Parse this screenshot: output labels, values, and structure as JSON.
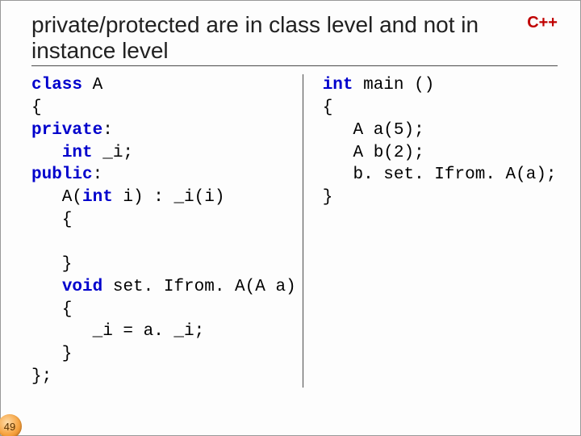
{
  "title": "private/protected are in class level and not in instance level",
  "lang_badge": "C++",
  "page_number": "49",
  "code_tokens": {
    "kw_class": "class",
    "kw_private": "private",
    "kw_public": "public",
    "kw_int": "int",
    "kw_void": "void"
  },
  "code_left": {
    "l1_rest": " A",
    "l2": "{",
    "l3_rest": ":",
    "l4_rest": " _i;",
    "l5_rest": ":",
    "l6_pre": "   A(",
    "l6_rest": " i) : _i(i)",
    "l7": "   {",
    "l8": "",
    "l9": "   }",
    "l10_rest": " set. Ifrom. A(A a)",
    "l11": "   {",
    "l12": "      _i = a. _i;",
    "l13": "   }",
    "l14": "};"
  },
  "code_right": {
    "r1_rest": " main ()",
    "r2": "{",
    "r3": "   A a(5);",
    "r4": "   A b(2);",
    "r5": "   b. set. Ifrom. A(a);",
    "r6": "}"
  }
}
